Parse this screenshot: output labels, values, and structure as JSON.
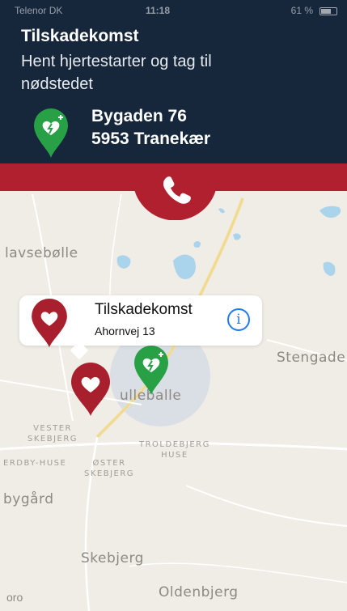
{
  "status_bar": {
    "left": "Telenor DK",
    "time": "11:18",
    "right": "61 %"
  },
  "header": {
    "title": "Tilskadekomst",
    "subtitle": "Hent hjertestarter og tag til nødstedet",
    "address_line1": "Bygaden 76",
    "address_line2": "5953 Tranekær"
  },
  "call_button": {
    "icon": "phone-icon"
  },
  "callout": {
    "title": "Tilskadekomst",
    "subtitle": "Ahornvej 13",
    "icon": "info-icon"
  },
  "map": {
    "places": {
      "p1": "lavsebølle",
      "p2": "Stengade",
      "p3": "ulleballe",
      "p4_line1": "VESTER",
      "p4_line2": "SKEBJERG",
      "p5_line1": "TROLDEBJERG",
      "p5_line2": "HUSE",
      "p6_line1": "ØSTER",
      "p6_line2": "SKEBJERG",
      "p7": "ERDBY-HUSE",
      "p8": "bygård",
      "p9": "Skebjerg",
      "p10": "Oldenbjerg"
    },
    "legal": "oro"
  },
  "colors": {
    "header_bg": "#16263b",
    "accent_red": "#b0202e",
    "aed_green": "#27a046",
    "info_blue": "#1e7cf2"
  }
}
